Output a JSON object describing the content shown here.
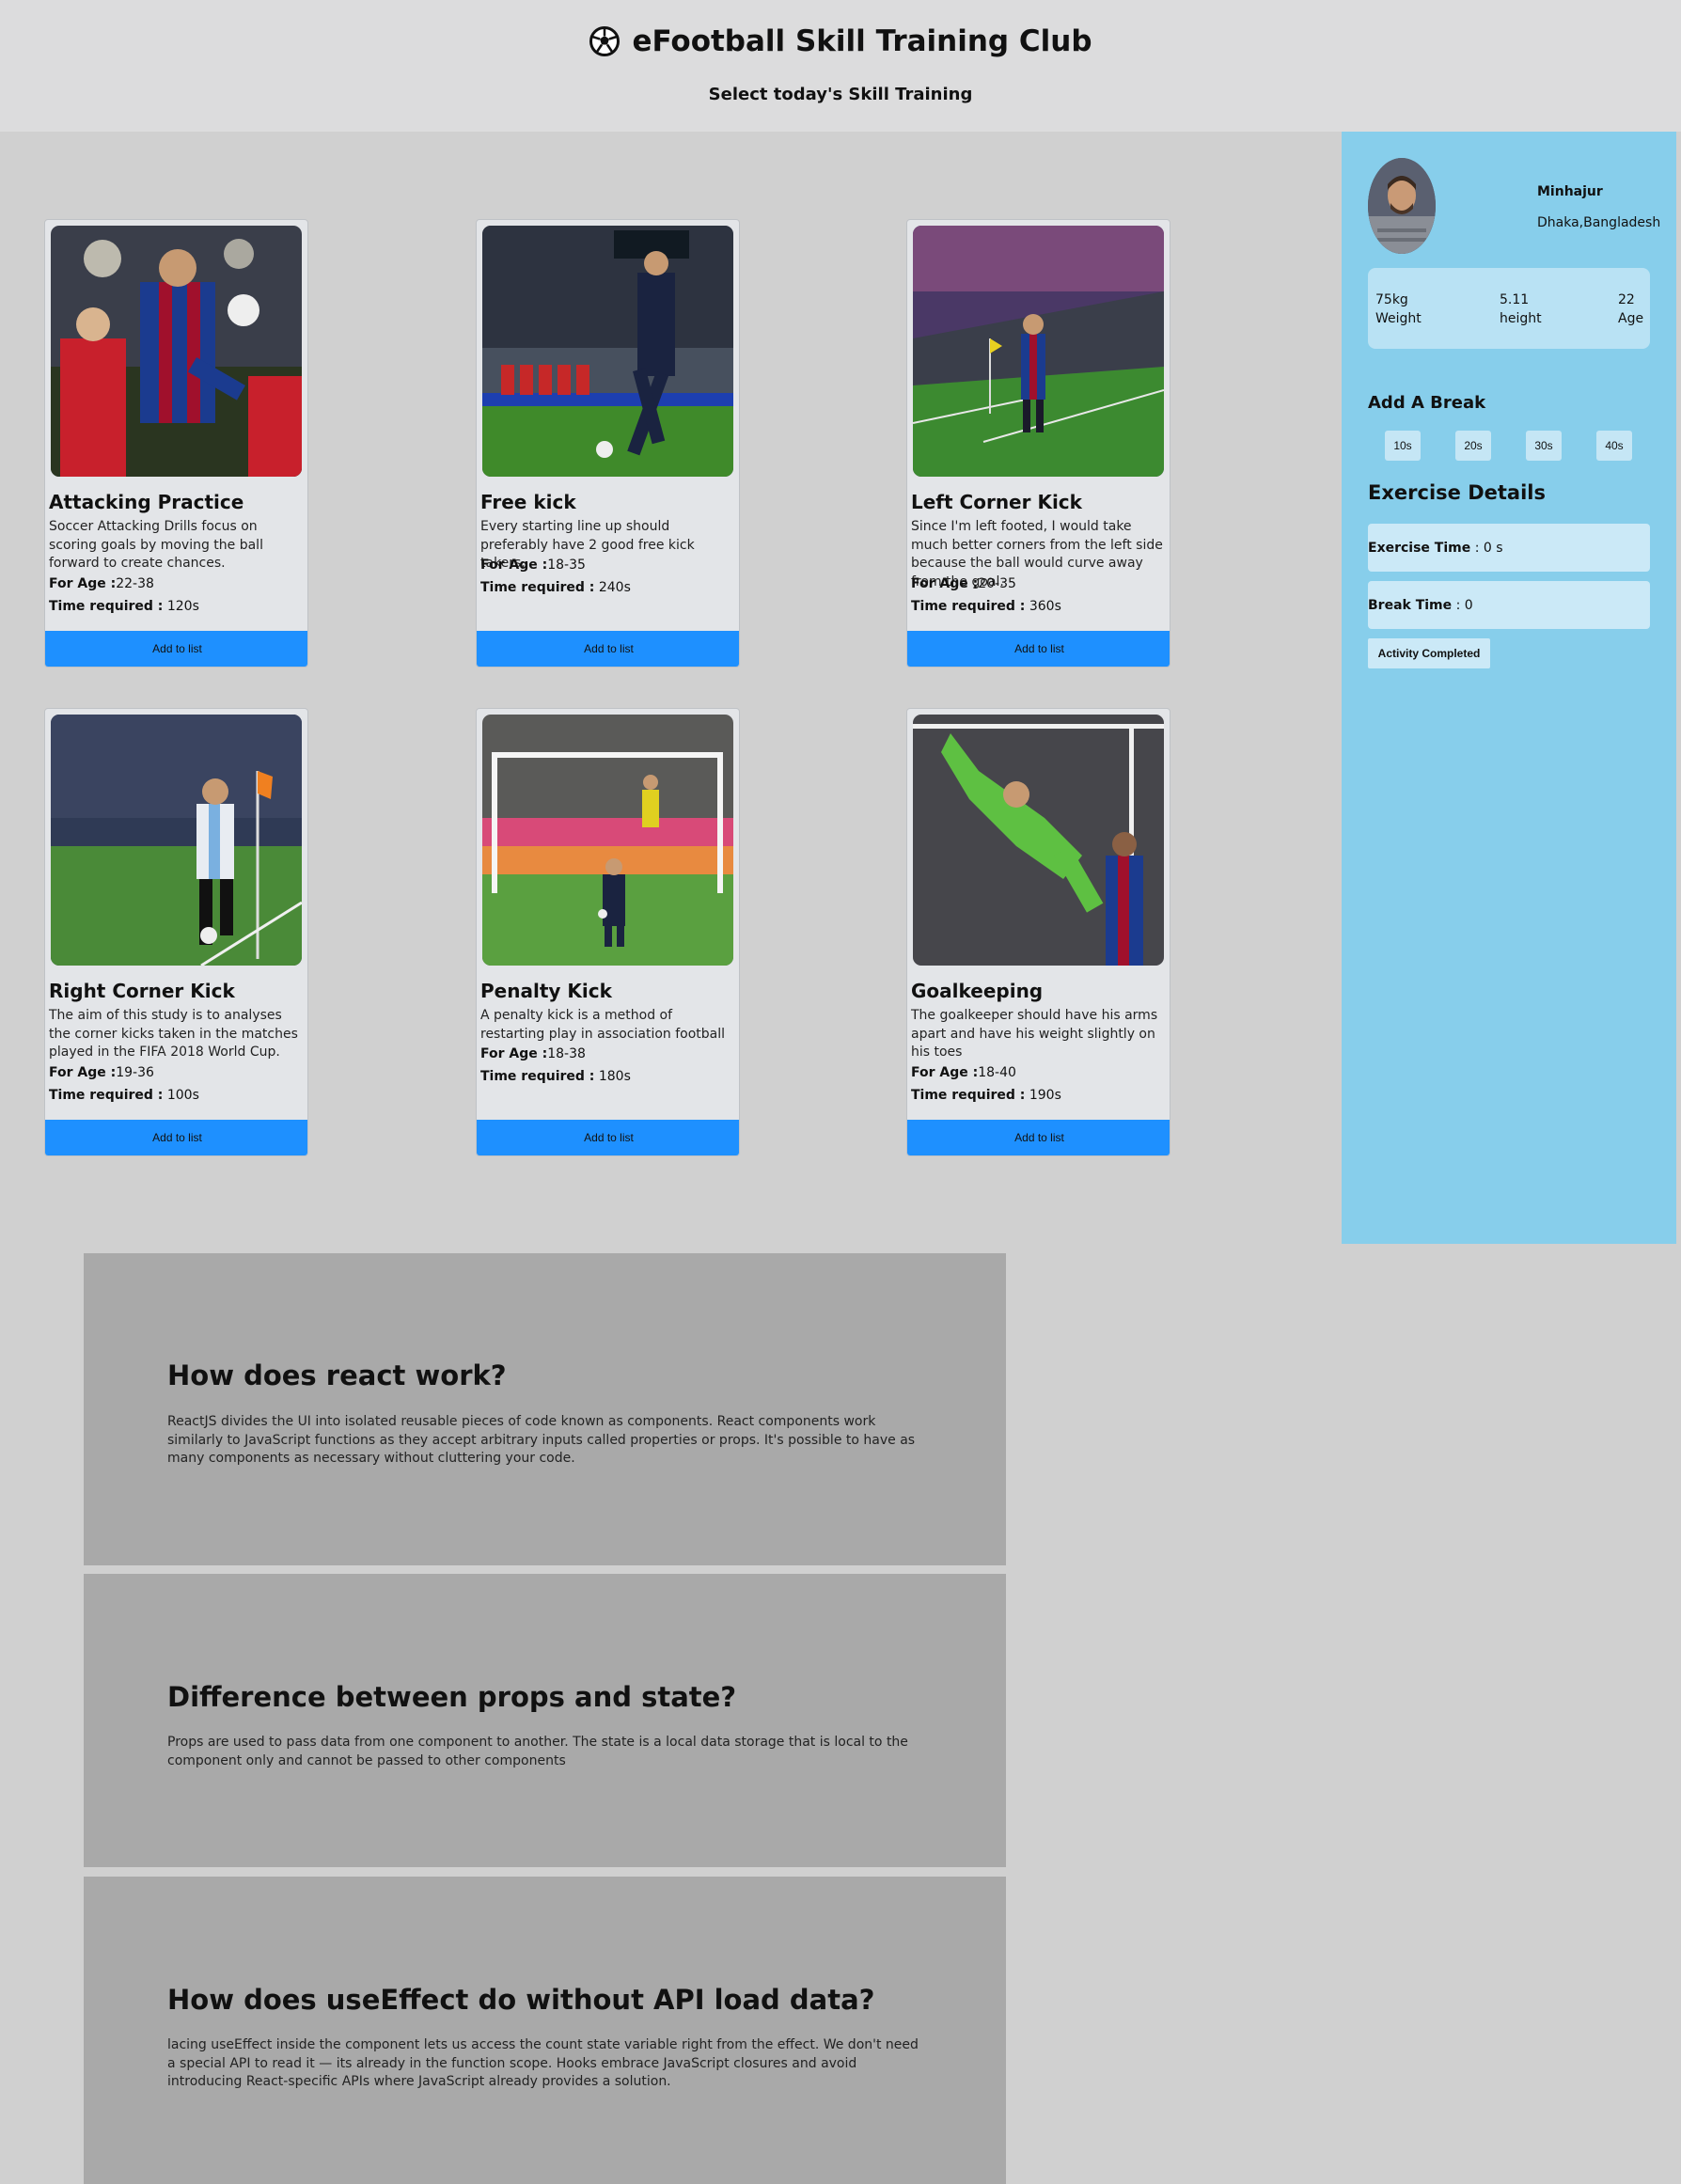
{
  "header": {
    "title": "eFootball Skill Training Club",
    "subtitle": "Select today's Skill Training",
    "icon": "soccer-ball-icon"
  },
  "cards": [
    {
      "name": "Attacking Practice",
      "desc": "Soccer Attacking Drills focus on scoring goals by moving the ball forward to create chances.",
      "age_label": "For Age :",
      "age": "22-38",
      "time_label": "Time required :",
      "time": "120s",
      "button": "Add to list"
    },
    {
      "name": "Free kick",
      "desc": "Every starting line up should preferably have 2 good free kick takers.",
      "age_label": "For Age :",
      "age": "18-35",
      "time_label": "Time required :",
      "time": "240s",
      "button": "Add to list"
    },
    {
      "name": "Left Corner Kick",
      "desc": "Since I'm left footed, I would take much better corners from the left side because the ball would curve away from the goal.",
      "age_label": "For Age :",
      "age": "20-35",
      "time_label": "Time required :",
      "time": "360s",
      "button": "Add to list"
    },
    {
      "name": "Right Corner Kick",
      "desc": "The aim of this study is to analyses the corner kicks taken in the matches played in the FIFA 2018 World Cup.",
      "age_label": "For Age :",
      "age": "19-36",
      "time_label": "Time required :",
      "time": "100s",
      "button": "Add to list"
    },
    {
      "name": "Penalty Kick",
      "desc": "A penalty kick is a method of restarting play in association football",
      "age_label": "For Age :",
      "age": "18-38",
      "time_label": "Time required :",
      "time": "180s",
      "button": "Add to list"
    },
    {
      "name": "Goalkeeping",
      "desc": "The goalkeeper should have his arms apart and have his weight slightly on his toes",
      "age_label": "For Age :",
      "age": "18-40",
      "time_label": "Time required :",
      "time": "190s",
      "button": "Add to list"
    }
  ],
  "profile": {
    "name": "Minhajur",
    "location": "Dhaka,Bangladesh",
    "stats": [
      {
        "value": "75kg",
        "label": "Weight"
      },
      {
        "value": "5.11",
        "label": "height"
      },
      {
        "value": "22",
        "label": "Age"
      }
    ]
  },
  "breaks": {
    "title": "Add A Break",
    "options": [
      "10s",
      "20s",
      "30s",
      "40s"
    ]
  },
  "exercise": {
    "title": "Exercise Details",
    "exercise_label": "Exercise Time",
    "exercise_value": ": 0 s",
    "break_label": "Break Time",
    "break_value": ": 0",
    "done_button": "Activity Completed"
  },
  "qa": [
    {
      "q": "How does react work?",
      "a": "ReactJS divides the UI into isolated reusable pieces of code known as components. React components work similarly to JavaScript functions as they accept arbitrary inputs called properties or props. It's possible to have as many components as necessary without cluttering your code."
    },
    {
      "q": "Difference between props and state?",
      "a": "Props are used to pass data from one component to another. The state is a local data storage that is local to the component only and cannot be passed to other components"
    },
    {
      "q": "How does useEffect do without API load data?",
      "a": "lacing useEffect inside the component lets us access the count state variable right from the effect. We don't need a special API to read it — its already in the function scope. Hooks embrace JavaScript closures and avoid introducing React-specific APIs where JavaScript already provides a solution."
    }
  ],
  "colors": {
    "accent": "#1e90ff",
    "sidebar": "#87ceeb",
    "qa_bg": "#a9a9a9"
  }
}
